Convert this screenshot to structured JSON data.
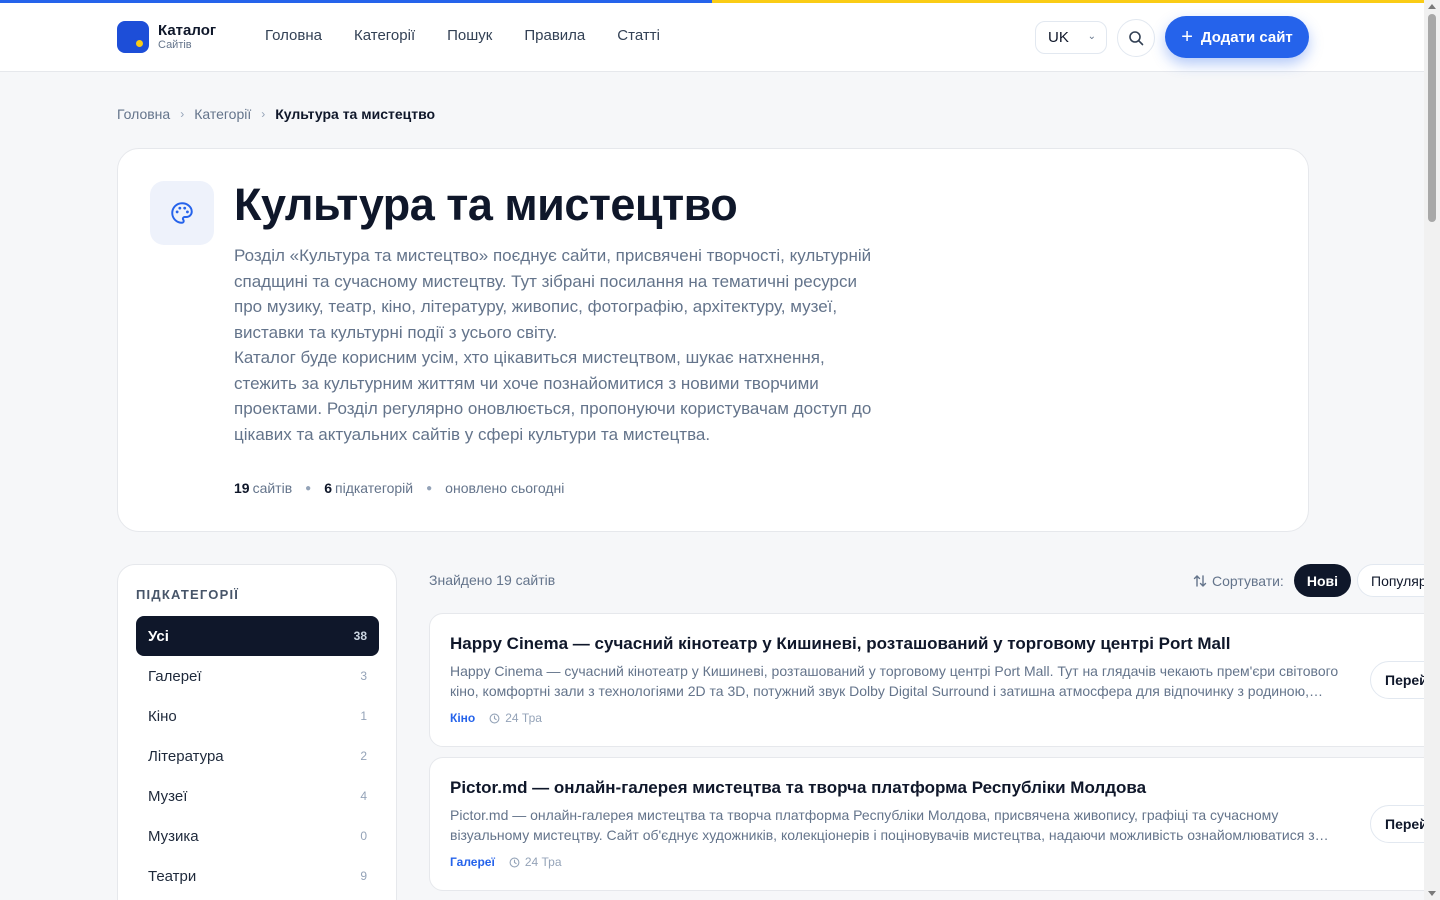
{
  "colors": {
    "accent": "#2563eb",
    "flag_blue": "#2563eb",
    "flag_yellow": "#facc15",
    "dark": "#0f172a"
  },
  "header": {
    "logo_title": "Каталог",
    "logo_sub": "Сайтів",
    "nav": [
      "Головна",
      "Категорії",
      "Пошук",
      "Правила",
      "Статті"
    ],
    "lang": "UK",
    "add_label": "Додати сайт"
  },
  "breadcrumb": {
    "home": "Головна",
    "categories": "Категорії",
    "current": "Культура та мистецтво"
  },
  "hero": {
    "icon": "palette-icon",
    "title": "Культура та мистецтво",
    "desc1": "Розділ «Культура та мистецтво» поєднує сайти, присвячені творчості, культурній спадщині та сучасному мистецтву. Тут зібрані посилання на тематичні ресурси про музику, театр, кіно, літературу, живопис, фотографію, архітектуру, музеї, виставки та культурні події з усього світу.",
    "desc2": "Каталог буде корисним усім, хто цікавиться мистецтвом, шукає натхнення, стежить за культурним життям чи хоче познайомитися з новими творчими проектами. Розділ регулярно оновлюється, пропонуючи користувачам доступ до цікавих та актуальних сайтів у сфері культури та мистецтва.",
    "stat_sites_num": "19",
    "stat_sites_label": "сайтів",
    "stat_subcats_num": "6",
    "stat_subcats_label": "підкатегорій",
    "stat_updated": "оновлено сьогодні"
  },
  "sidebar": {
    "heading": "ПІДКАТЕГОРІЇ",
    "items": [
      {
        "label": "Усі",
        "count": "38"
      },
      {
        "label": "Галереї",
        "count": "3"
      },
      {
        "label": "Кіно",
        "count": "1"
      },
      {
        "label": "Література",
        "count": "2"
      },
      {
        "label": "Музеї",
        "count": "4"
      },
      {
        "label": "Музика",
        "count": "0"
      },
      {
        "label": "Театри",
        "count": "9"
      }
    ]
  },
  "results": {
    "found": "Знайдено 19 сайтів",
    "sort_label": "Сортувати:",
    "sort_new": "Нові",
    "sort_popular": "Популярні"
  },
  "cards": [
    {
      "title": "Happy Cinema — сучасний кінотеатр у Кишиневі, розташований у торговому центрі Port Mall",
      "desc": "Happy Cinema — сучасний кінотеатр у Кишиневі, розташований у торговому центрі Port Mall. Тут на глядачів чекають прем'єри світового кіно, комфортні зали з технологіями 2D та 3D, потужний звук Dolby Digital Surround і затишна атмосфера для відпочинку з родиною, друзями або на побаченні.",
      "tag": "Кіно",
      "date": "24 Тра",
      "button": "Перейти"
    },
    {
      "title": "Pictor.md — онлайн-галерея мистецтва та творча платформа Республіки Молдова",
      "desc": "Pictor.md — онлайн-галерея мистецтва та творча платформа Республіки Молдова, присвячена живопису, графіці та сучасному візуальному мистецтву. Сайт об'єднує художників, колекціонерів і поціновувачів мистецтва, надаючи можливість ознайомлюватися з авторськими роботами.",
      "tag": "Галереї",
      "date": "24 Тра",
      "button": "Перейти"
    }
  ]
}
